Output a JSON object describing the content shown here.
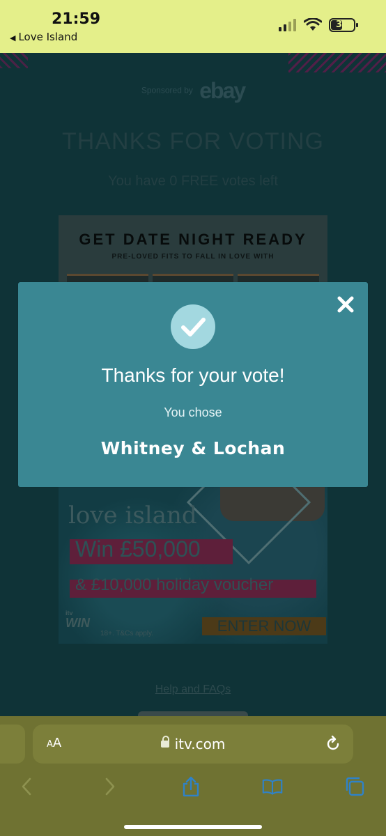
{
  "status_bar": {
    "time": "21:59",
    "back_app": "Love Island",
    "battery_level": "37",
    "icons": [
      "signal-icon",
      "wifi-icon",
      "battery-icon"
    ],
    "background_color": "#e4ef8a"
  },
  "page": {
    "sponsored_label": "Sponsored by",
    "sponsor_logo": "ebay",
    "heading": "THANKS FOR VOTING",
    "votes_left": "You have 0 FREE votes left",
    "ad_top": {
      "title": "GET DATE NIGHT READY",
      "subtitle": "PRE-LOVED FITS TO FALL IN LOVE WITH"
    },
    "ad_bottom": {
      "logo_text": "love island",
      "win_text": "Win £50,000",
      "holiday_text": "& £10,000 holiday voucher",
      "brand": "WIN",
      "brand_small": "itv",
      "terms": "18+. T&Cs apply.",
      "cta": "ENTER NOW"
    },
    "help_link": "Help and FAQs"
  },
  "modal": {
    "title": "Thanks for your vote!",
    "subtitle": "You chose",
    "choice": "Whitney & Lochan",
    "background_color": "#3a8793",
    "check_color": "#a3d8e0",
    "close_icon": "close-icon",
    "check_icon": "checkmark-icon"
  },
  "browser": {
    "text_size_label_small": "A",
    "text_size_label_large": "A",
    "url": "itv.com",
    "toolbar": [
      "back-icon",
      "forward-icon",
      "share-icon",
      "bookmarks-icon",
      "tabs-icon"
    ]
  }
}
